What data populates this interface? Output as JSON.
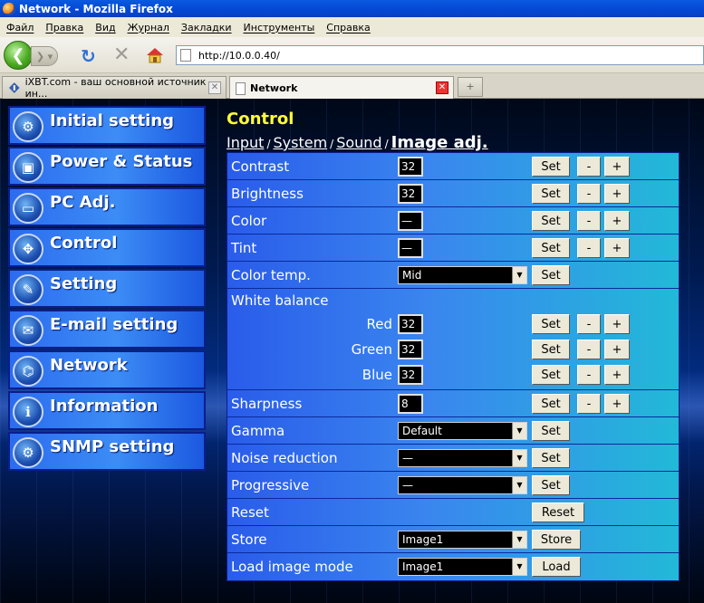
{
  "window": {
    "title": "Network - Mozilla Firefox"
  },
  "menu": [
    "Файл",
    "Правка",
    "Вид",
    "Журнал",
    "Закладки",
    "Инструменты",
    "Справка"
  ],
  "address": {
    "url": "http://10.0.0.40/"
  },
  "tabs": [
    {
      "label": "iXBT.com - ваш основной источник ин...",
      "active": false
    },
    {
      "label": "Network",
      "active": true
    }
  ],
  "sidebar": {
    "items": [
      {
        "label": "Initial setting"
      },
      {
        "label": "Power & Status"
      },
      {
        "label": "PC Adj."
      },
      {
        "label": "Control"
      },
      {
        "label": "Setting"
      },
      {
        "label": "E-mail setting"
      },
      {
        "label": "Network"
      },
      {
        "label": "Information"
      },
      {
        "label": "SNMP setting"
      }
    ]
  },
  "main": {
    "title": "Control",
    "breadcrumb": {
      "input": "Input",
      "system": "System",
      "sound": "Sound",
      "current": "Image adj.",
      "sep": "/"
    },
    "buttons": {
      "set": "Set",
      "minus": "-",
      "plus": "+",
      "reset": "Reset",
      "store": "Store",
      "load": "Load"
    },
    "rows": {
      "contrast": {
        "label": "Contrast",
        "value": "32"
      },
      "brightness": {
        "label": "Brightness",
        "value": "32"
      },
      "color": {
        "label": "Color",
        "value": "—"
      },
      "tint": {
        "label": "Tint",
        "value": "—"
      },
      "color_temp": {
        "label": "Color temp.",
        "value": "Mid"
      },
      "white_balance": {
        "label": "White balance",
        "red": {
          "label": "Red",
          "value": "32"
        },
        "green": {
          "label": "Green",
          "value": "32"
        },
        "blue": {
          "label": "Blue",
          "value": "32"
        }
      },
      "sharpness": {
        "label": "Sharpness",
        "value": "8"
      },
      "gamma": {
        "label": "Gamma",
        "value": "Default"
      },
      "noise_reduction": {
        "label": "Noise reduction",
        "value": "—"
      },
      "progressive": {
        "label": "Progressive",
        "value": "—"
      },
      "reset": {
        "label": "Reset"
      },
      "store": {
        "label": "Store",
        "value": "Image1"
      },
      "load_image_mode": {
        "label": "Load image mode",
        "value": "Image1"
      }
    }
  },
  "colors": {
    "title_yellow": "#ffff33",
    "sidebar_blue": "#2c6cef",
    "row_cyan": "#22b9d8"
  }
}
